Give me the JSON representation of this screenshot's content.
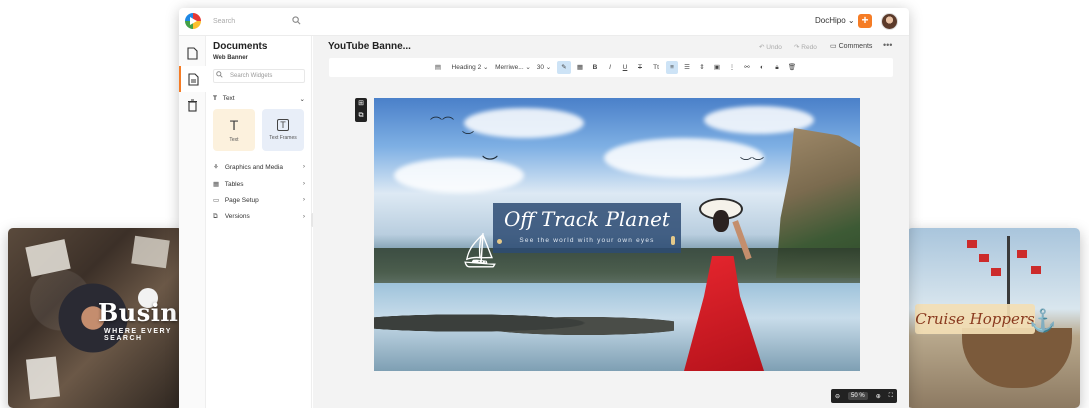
{
  "left_preview": {
    "title": "Business",
    "subtitle": "WHERE EVERY SEARCH"
  },
  "right_preview": {
    "title": "Cruise Hoppers",
    "icon": "ship-icon"
  },
  "topbar": {
    "search_placeholder": "Search",
    "brand_dropdown": "DocHipo ⌄",
    "add_label": "+"
  },
  "rail": {
    "items": [
      "document-icon",
      "page-icon",
      "trash-icon"
    ]
  },
  "panel": {
    "title": "Documents",
    "subtitle": "Web Banner",
    "search_placeholder": "Search Widgets",
    "text_section": "Text",
    "widgets": [
      {
        "label": "Text"
      },
      {
        "label": "Text Frames"
      }
    ],
    "menu": [
      {
        "label": "Graphics and Media"
      },
      {
        "label": "Tables"
      },
      {
        "label": "Page Setup"
      },
      {
        "label": "Versions"
      }
    ]
  },
  "header": {
    "doc_title": "YouTube Banne...",
    "undo": "Undo",
    "redo": "Redo",
    "comments": "Comments",
    "more": "•••"
  },
  "toolbar": {
    "heading_style": "Heading 2",
    "font_family": "Merriwe...",
    "font_size": "30"
  },
  "canvas": {
    "headline": "Off Track Planet",
    "tagline": "See the world with your own eyes"
  },
  "zoom": {
    "value": "50 %"
  },
  "colors": {
    "accent": "#f57c25",
    "frame": "#2d4b73",
    "dress": "#d4161f"
  }
}
